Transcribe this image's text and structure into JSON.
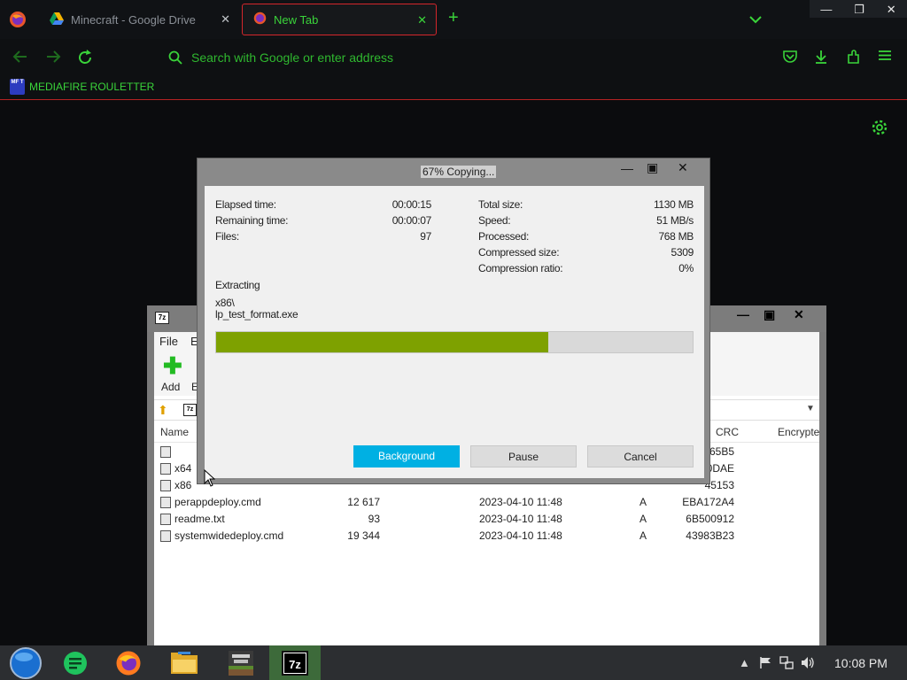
{
  "browser": {
    "tabs": [
      {
        "label": "Minecraft - Google Drive",
        "icon": "google-drive-icon"
      },
      {
        "label": "New Tab",
        "icon": "firefox-icon",
        "active": true
      }
    ],
    "urlbar_placeholder": "Search with Google or enter address",
    "bookmark": {
      "icon_text": "MF T",
      "label": "MEDIAFIRE ROULETTER"
    },
    "accent_color": "#3ad43a",
    "border_color": "#d4262b"
  },
  "file_manager": {
    "title_icon": "7z",
    "menu": [
      "File",
      "E"
    ],
    "toolbar": {
      "add_label": "Add",
      "second_label": "E"
    },
    "columns": {
      "name": "Name",
      "crc": "CRC",
      "encrypted": "Encrypte"
    },
    "rows": [
      {
        "name": "",
        "size": "",
        "date": "",
        "attr": "",
        "crc": "365B5"
      },
      {
        "name": "x64",
        "size": "",
        "date": "",
        "attr": "",
        "crc": "0DAE"
      },
      {
        "name": "x86",
        "size": "",
        "date": "",
        "attr": "",
        "crc": "45153"
      },
      {
        "name": "perappdeploy.cmd",
        "size": "12 617",
        "date": "2023-04-10 11:48",
        "attr": "A",
        "crc": "EBA172A4"
      },
      {
        "name": "readme.txt",
        "size": "93",
        "date": "2023-04-10 11:48",
        "attr": "A",
        "crc": "6B500912"
      },
      {
        "name": "systemwidedeploy.cmd",
        "size": "19 344",
        "date": "2023-04-10 11:48",
        "attr": "A",
        "crc": "43983B23"
      }
    ]
  },
  "dialog": {
    "title": "67% Copying...",
    "progress_fraction": 0.697,
    "left_stats": [
      {
        "label": "Elapsed time:",
        "value": "00:00:15"
      },
      {
        "label": "Remaining time:",
        "value": "00:00:07"
      },
      {
        "label": "Files:",
        "value": "97"
      }
    ],
    "right_stats": [
      {
        "label": "Total size:",
        "value": "1130 MB"
      },
      {
        "label": "Speed:",
        "value": "51 MB/s"
      },
      {
        "label": "Processed:",
        "value": "768 MB"
      },
      {
        "label": "Compressed size:",
        "value": "5309"
      },
      {
        "label": "Compression ratio:",
        "value": "0%"
      }
    ],
    "status": "Extracting",
    "path_line1": "x86\\",
    "path_line2": "lp_test_format.exe",
    "buttons": {
      "background": "Background",
      "pause": "Pause",
      "cancel": "Cancel"
    },
    "progress_color": "#7ea100",
    "primary_button_color": "#00b0e3"
  },
  "taskbar": {
    "clock": "10:08 PM",
    "apps": [
      "start-orb-icon",
      "notes-app-icon",
      "firefox-icon",
      "file-explorer-icon",
      "minecraft-launcher-icon",
      "7zip-icon"
    ],
    "tray_icons": [
      "chevron-up-icon",
      "flag-icon",
      "network-icon",
      "volume-icon"
    ]
  }
}
